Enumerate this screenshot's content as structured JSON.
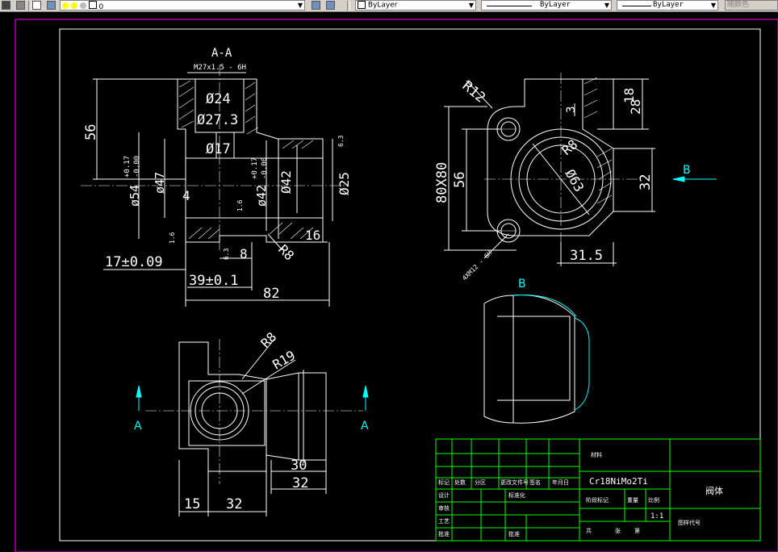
{
  "toolbar": {
    "layer_value": "0",
    "color_value": "ByLayer",
    "linetype_value": "ByLayer",
    "lineweight_value": "ByLayer",
    "plotstyle_value": "随颜色"
  },
  "drawing": {
    "section_title": "A-A",
    "thread_label": "M27x1.5 - 6H",
    "dims_section": {
      "d24": "Ø24",
      "d27": "Ø27.3",
      "d17": "Ø17",
      "h56": "56",
      "d54": "ø54",
      "d54_tol_up": "+0.17",
      "d54_tol_dn": "-0.00",
      "d47": "ø47",
      "d42tol": "ø42",
      "d42_tol_up": "+0.17",
      "d42_tol_dn": "-0.00",
      "d42": "Ø42",
      "d25": "Ø25",
      "four": "4",
      "r8": "R8",
      "w16": "16",
      "w8": "8",
      "l17": "17±0.09",
      "l39": "39±0.1",
      "l82": "82",
      "rough63a": "6.3",
      "rough63b": "6.3",
      "rough16a": "1.6",
      "rough16b": "1.6"
    },
    "dims_side": {
      "r12": "R12",
      "h18": "18",
      "h28": "28",
      "h3": "3",
      "r8": "R8",
      "d63": "Ø63",
      "sq80": "80X80",
      "h56": "56",
      "h32": "32",
      "w315": "31.5",
      "holes": "4XM12 - 6H"
    },
    "dims_plan": {
      "r8": "R8",
      "r19": "R19",
      "w30": "30",
      "w32a": "32",
      "w15": "15",
      "w32b": "32"
    },
    "view_labels": {
      "b_arrow": "B",
      "b_view": "B",
      "a_left": "A",
      "a_right": "A"
    },
    "title_block": {
      "material": "Cr18NiMo2Ti",
      "part_name": "阀体",
      "scale": "1:1",
      "material_label": "材料",
      "drawing_no_label": "图样代号",
      "mark": "标记",
      "count": "处数",
      "zone": "分区",
      "change_no": "更改文件号",
      "sign": "签名",
      "date": "年月日",
      "design": "设计",
      "standardize": "标准化",
      "stage_mark": "阶段标记",
      "weight": "重量",
      "ratio": "比例",
      "review": "审核",
      "process": "工艺",
      "approve": "批准",
      "total": "共",
      "sheet": "张",
      "page": "第"
    }
  }
}
